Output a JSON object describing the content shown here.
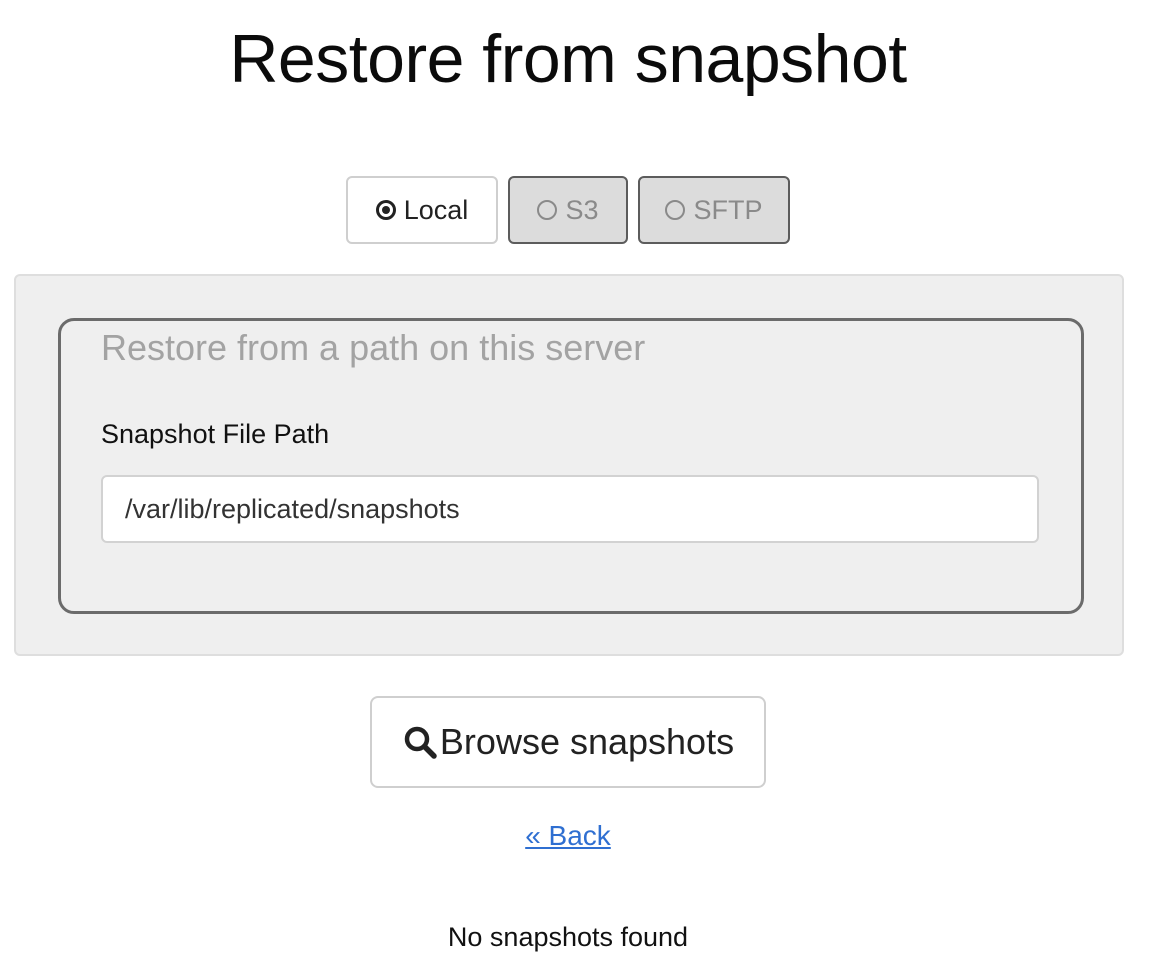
{
  "page": {
    "title": "Restore from snapshot"
  },
  "source_tabs": [
    {
      "label": "Local",
      "selected": true
    },
    {
      "label": "S3",
      "selected": false
    },
    {
      "label": "SFTP",
      "selected": false
    }
  ],
  "local_panel": {
    "legend": "Restore from a path on this server",
    "path_label": "Snapshot File Path",
    "path_value": "/var/lib/replicated/snapshots"
  },
  "actions": {
    "browse_label": "Browse snapshots",
    "back_label": "« Back"
  },
  "status": {
    "message": "No snapshots found"
  },
  "icons": {
    "browse": "search-icon",
    "radio_selected": "radio-selected-icon",
    "radio_unselected": "radio-unselected-icon"
  },
  "colors": {
    "link": "#2f6fd1",
    "panel_bg": "#efefef",
    "tab_inactive_bg": "#dcdcdc",
    "legend_text": "#a3a3a3"
  }
}
